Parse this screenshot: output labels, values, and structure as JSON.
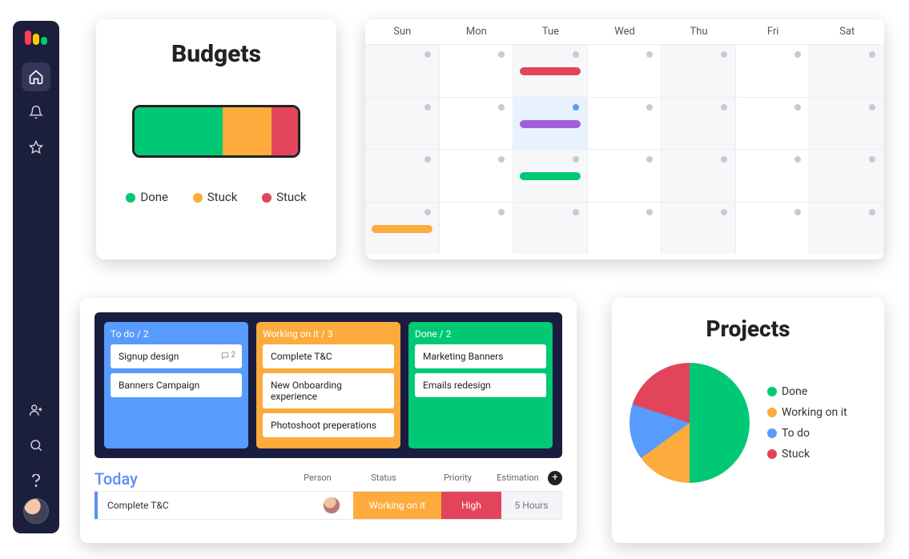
{
  "colors": {
    "green": "#00c875",
    "orange": "#fdab3d",
    "red": "#e2445c",
    "blue": "#579bfc",
    "purple": "#a25ddc"
  },
  "sidebar": {
    "icons": [
      "home",
      "bell",
      "star",
      "add-user",
      "search",
      "help"
    ]
  },
  "budgets": {
    "title": "Budgets",
    "segments": [
      {
        "label": "Done",
        "color": "green",
        "width": 54
      },
      {
        "label": "Stuck",
        "color": "orange",
        "width": 30
      },
      {
        "label": "Stuck",
        "color": "red",
        "width": 16
      }
    ],
    "legend": [
      {
        "label": "Done",
        "color": "green"
      },
      {
        "label": "Stuck",
        "color": "orange"
      },
      {
        "label": "Stuck",
        "color": "red"
      }
    ]
  },
  "calendar": {
    "days": [
      "Sun",
      "Mon",
      "Tue",
      "Wed",
      "Thu",
      "Fri",
      "Sat"
    ],
    "highlight": {
      "row": 1,
      "col": 2
    },
    "bluedot": {
      "row": 1,
      "col": 2
    },
    "events": [
      {
        "row": 0,
        "col": 2,
        "span": 1,
        "color": "red"
      },
      {
        "row": 1,
        "col": 2,
        "span": 1,
        "color": "purple"
      },
      {
        "row": 2,
        "col": 2,
        "span": 1,
        "color": "green"
      },
      {
        "row": 3,
        "col": 0,
        "span": 1,
        "color": "orange"
      }
    ]
  },
  "kanban": {
    "columns": [
      {
        "title": "To do / 2",
        "color": "#579bfc",
        "cards": [
          {
            "text": "Signup design",
            "comments": 2
          },
          {
            "text": "Banners Campaign"
          }
        ]
      },
      {
        "title": "Working on it / 3",
        "color": "#fdab3d",
        "cards": [
          {
            "text": "Complete T&C"
          },
          {
            "text": "New Onboarding experience"
          },
          {
            "text": "Photoshoot preperations"
          }
        ]
      },
      {
        "title": "Done / 2",
        "color": "#00c875",
        "cards": [
          {
            "text": "Marketing Banners"
          },
          {
            "text": "Emails redesign"
          }
        ]
      }
    ]
  },
  "today": {
    "title": "Today",
    "headers": {
      "person": "Person",
      "status": "Status",
      "priority": "Priority",
      "estimation": "Estimation"
    },
    "row": {
      "name": "Complete T&C",
      "status": "Working on it",
      "priority": "High",
      "estimation": "5 Hours"
    }
  },
  "projects": {
    "title": "Projects",
    "legend": [
      {
        "label": "Done",
        "color": "green"
      },
      {
        "label": "Working on it",
        "color": "orange"
      },
      {
        "label": "To do",
        "color": "blue"
      },
      {
        "label": "Stuck",
        "color": "red"
      }
    ]
  },
  "chart_data": [
    {
      "type": "bar",
      "title": "Budgets",
      "orientation": "single-stacked",
      "categories": [
        "Done",
        "Stuck",
        "Stuck"
      ],
      "values": [
        54,
        30,
        16
      ],
      "unit": "percent"
    },
    {
      "type": "pie",
      "title": "Projects",
      "series": [
        {
          "name": "Done",
          "value": 50
        },
        {
          "name": "Working on it",
          "value": 15
        },
        {
          "name": "To do",
          "value": 15
        },
        {
          "name": "Stuck",
          "value": 20
        }
      ]
    }
  ]
}
